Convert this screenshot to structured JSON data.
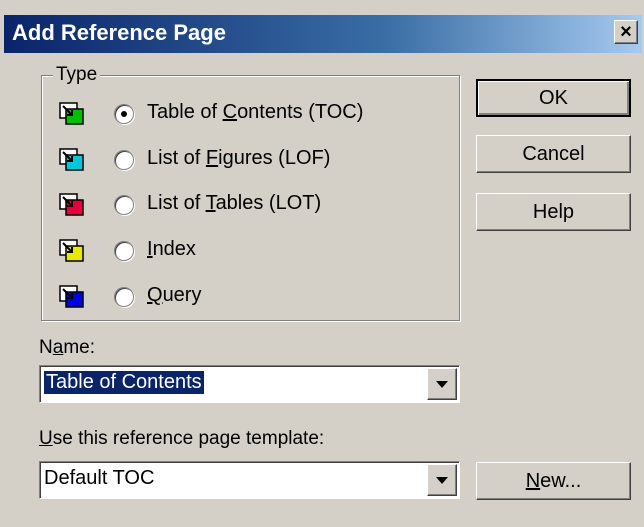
{
  "window": {
    "title": "Add Reference Page",
    "close_glyph": "×"
  },
  "type_group": {
    "label": "Type",
    "options": [
      {
        "label_pre": "Table of ",
        "mnemonic": "C",
        "label_post": "ontents (TOC)",
        "checked": true,
        "icon": "toc-icon",
        "icon_color": "#00c000"
      },
      {
        "label_pre": "List of ",
        "mnemonic": "F",
        "label_post": "igures (LOF)",
        "checked": false,
        "icon": "lof-icon",
        "icon_color": "#00c8d8"
      },
      {
        "label_pre": "List of ",
        "mnemonic": "T",
        "label_post": "ables (LOT)",
        "checked": false,
        "icon": "lot-icon",
        "icon_color": "#e8003a"
      },
      {
        "label_pre": "",
        "mnemonic": "I",
        "label_post": "ndex",
        "checked": false,
        "icon": "index-icon",
        "icon_color": "#e8e800"
      },
      {
        "label_pre": "",
        "mnemonic": "Q",
        "label_post": "uery",
        "checked": false,
        "icon": "query-icon",
        "icon_color": "#0000e8"
      }
    ]
  },
  "buttons": {
    "ok": "OK",
    "cancel": "Cancel",
    "help": "Help",
    "new_mnemonic": "N",
    "new_rest": "ew..."
  },
  "name_field": {
    "label_pre": "N",
    "label_mnemonic": "a",
    "label_post": "me:",
    "value": "Table of Contents"
  },
  "template_field": {
    "label_mnemonic": "U",
    "label_post": "se this reference page template:",
    "value": "Default TOC"
  }
}
